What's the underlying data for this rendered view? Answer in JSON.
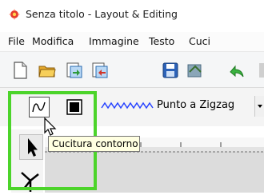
{
  "window": {
    "title": "Senza titolo - Layout & Editing"
  },
  "menu": {
    "items": [
      "File",
      "Modifica",
      "Immagine",
      "Testo",
      "Cuci"
    ]
  },
  "toolbar": {
    "buttons": [
      "new-file-icon",
      "open-folder-icon",
      "import-icon",
      "export-icon",
      "save-icon",
      "send-to-card-icon",
      "undo-icon"
    ]
  },
  "stitch": {
    "selected": "Punto a Zigzag"
  },
  "tooltip": {
    "text": "Cucitura contorno"
  },
  "colors": {
    "highlight": "#4cd42a",
    "tooltip_bg": "#ffffe1",
    "zigzag": "#2a46ff"
  }
}
